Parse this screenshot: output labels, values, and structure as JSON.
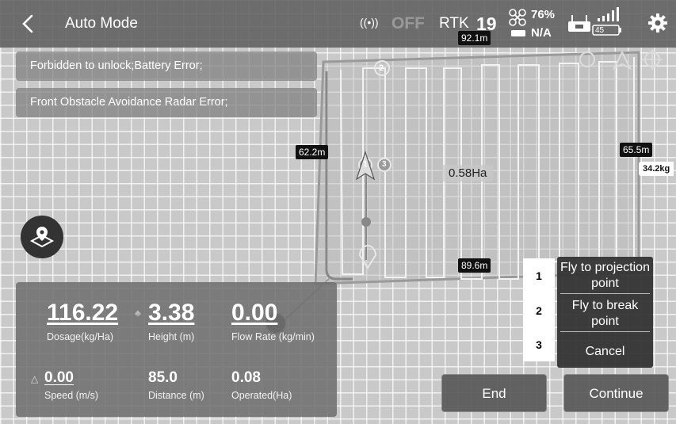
{
  "header": {
    "title": "Auto Mode",
    "signal_status": "OFF",
    "rtk_label": "RTK",
    "rtk_count": "19",
    "drone_battery": "76%",
    "drone_status": "N/A",
    "rc_battery": "45"
  },
  "warnings": [
    "Forbidden to unlock;Battery Error;",
    "Front Obstacle Avoidance Radar Error;"
  ],
  "map": {
    "dist_top": "92.1m",
    "dist_left": "62.2m",
    "dist_right": "65.5m",
    "dist_bottom": "89.6m",
    "weight": "34.2kg",
    "area": "0.58Ha",
    "waypoints": [
      "1",
      "2",
      "3"
    ]
  },
  "stats": {
    "dosage": {
      "value": "116.22",
      "label": "Dosage(kg/Ha)"
    },
    "height": {
      "value": "3.38",
      "label": "Height (m)"
    },
    "flow_rate": {
      "value": "0.00",
      "label": "Flow Rate (kg/min)"
    },
    "speed": {
      "value": "0.00",
      "label": "Speed (m/s)"
    },
    "distance": {
      "value": "85.0",
      "label": "Distance (m)"
    },
    "operated": {
      "value": "0.08",
      "label": "Operated(Ha)"
    }
  },
  "options": {
    "numbers": [
      "1",
      "2",
      "3"
    ],
    "items": [
      "Fly to projection point",
      "Fly to break point",
      "Cancel"
    ]
  },
  "actions": {
    "end": "End",
    "continue": "Continue"
  },
  "colors": {
    "accent_dark": "#333333",
    "warning_bg": "#808080",
    "waypoint": "#e0e0e0"
  }
}
